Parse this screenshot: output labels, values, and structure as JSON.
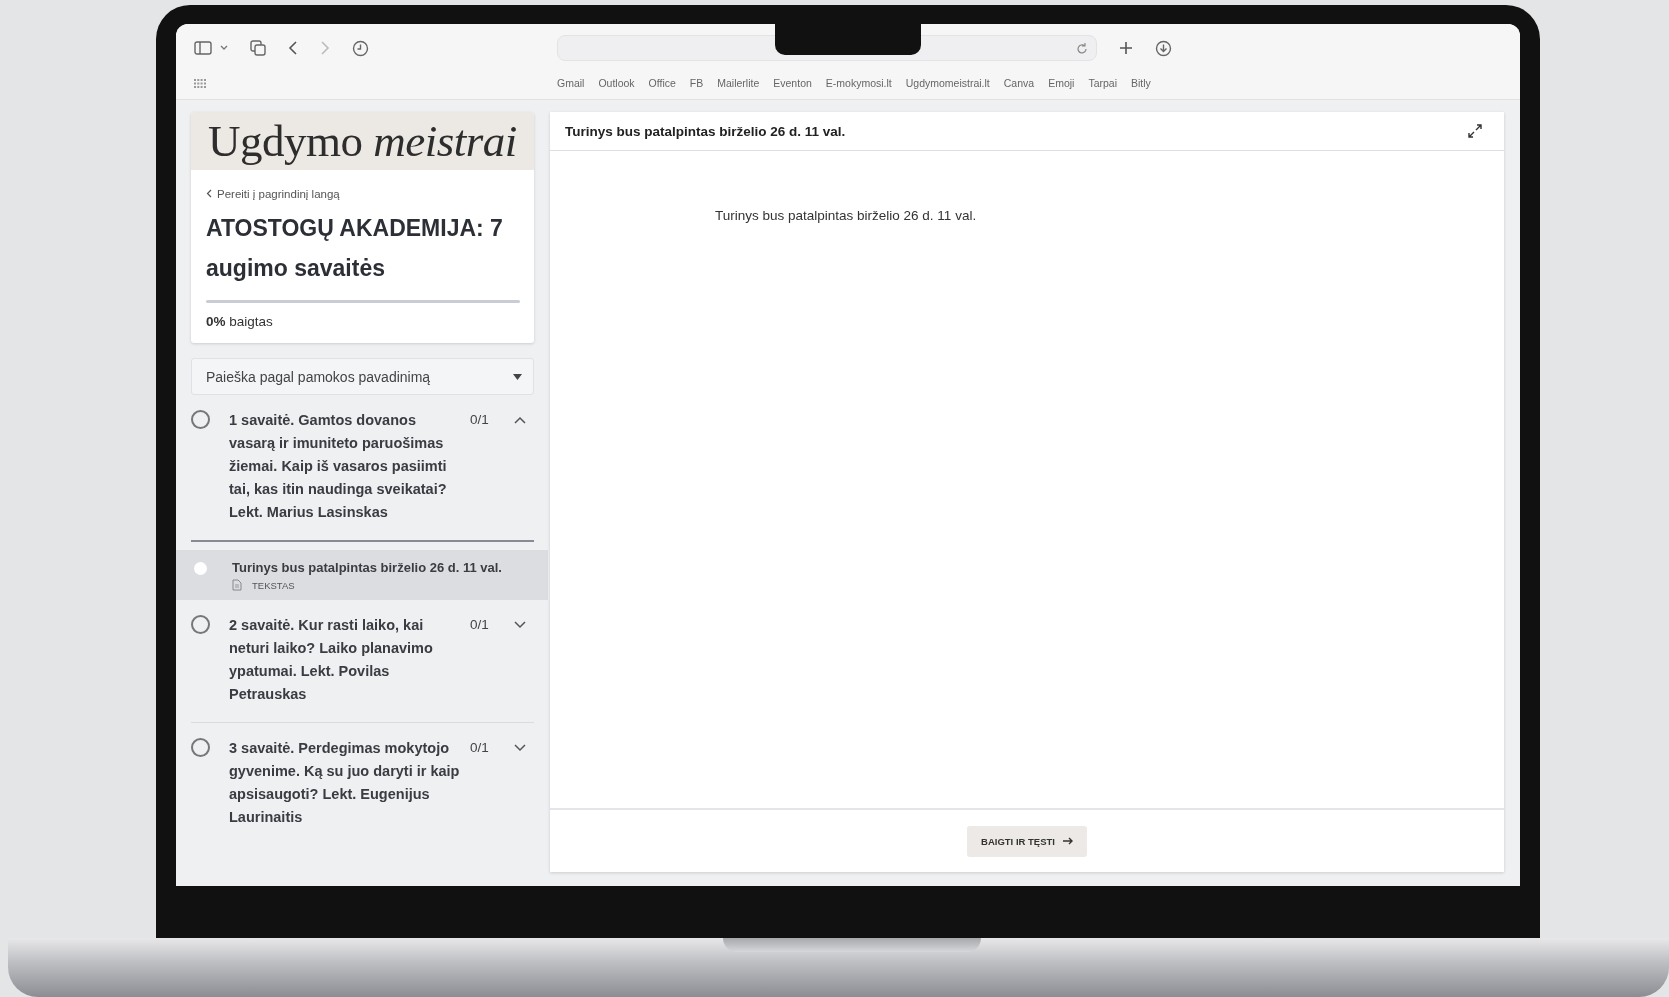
{
  "browser": {
    "bookmarks": [
      "Gmail",
      "Outlook",
      "Office",
      "FB",
      "Mailerlite",
      "Eventon",
      "E-mokymosi.lt",
      "Ugdymomeistrai.lt",
      "Canva",
      "Emoji",
      "Tarpai",
      "Bitly"
    ]
  },
  "sidebar": {
    "logo": "Ugdymo *meistrai*",
    "back_link": "Pereiti į pagrindinį langą",
    "course_title": "ATOSTOGŲ AKADEMIJA: 7 augimo savaitės",
    "progress": {
      "level": 0,
      "label": "**0%** baigtas"
    },
    "search": {
      "placeholder": "Paieška pagal pamokos pavadinimą"
    },
    "sections": [
      {
        "title": "1 savaitė. Gamtos dovanos vasarą ir imuniteto paruošimas žiemai. Kaip iš vasaros pasiimti tai, kas itin naudinga sveikatai? Lekt. Marius Lasinskas",
        "count": "0/1",
        "expanded": true,
        "completed": false,
        "lessons": [
          {
            "title": "Turinys bus patalpintas birželio 26 d. 11 val.",
            "type": "TEKSTAS",
            "selected": true,
            "completed": false
          }
        ]
      },
      {
        "title": "2 savaitė. Kur rasti laiko, kai neturi laiko? Laiko planavimo ypatumai. Lekt. Povilas Petrauskas",
        "count": "0/1",
        "expanded": false,
        "completed": false
      },
      {
        "title": "3 savaitė. Perdegimas mokytojo gyvenime. Ką su juo daryti ir kaip apsisaugoti? Lekt. Eugenijus Laurinaitis",
        "count": "0/1",
        "expanded": false,
        "completed": false
      }
    ]
  },
  "content": {
    "header_title": "Turinys bus patalpintas birželio 26 d. 11 val.",
    "body_text": "Turinys bus patalpintas birželio 26 d. 11 val.",
    "button": "BAIGTI IR TĘSTI"
  }
}
